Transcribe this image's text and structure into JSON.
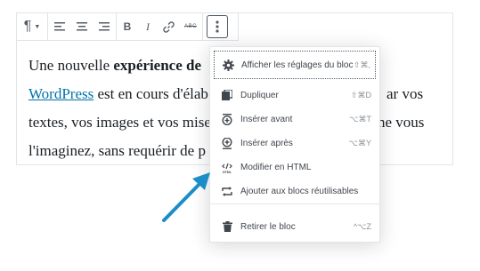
{
  "toolbar": {
    "paragraph_icon": "paragraph-icon",
    "align_left_icon": "align-left-icon",
    "align_center_icon": "align-center-icon",
    "align_right_icon": "align-right-icon",
    "bold_label": "B",
    "italic_label": "I",
    "link_icon": "link-icon",
    "strikethrough_label": "ABC",
    "more_icon": "more-vertical-icon"
  },
  "paragraph": {
    "line1_start": "Une nouvelle ",
    "line1_bold": "expérience de",
    "line1_end": " ",
    "line2_link": "WordPress",
    "line2_text": " est en cours d'élab",
    "line2_end": "ar vos",
    "line3_text": "textes, vos images et vos mise",
    "line3_end": "ne vous",
    "line4_text": "l'imaginez, sans requérir de p"
  },
  "menu": {
    "items": [
      {
        "label": "Afficher les réglages du bloc",
        "shortcut": "⇧⌘,",
        "icon": "gear-icon"
      },
      {
        "label": "Dupliquer",
        "shortcut": "⇧⌘D",
        "icon": "duplicate-icon"
      },
      {
        "label": "Insérer avant",
        "shortcut": "⌥⌘T",
        "icon": "insert-before-icon"
      },
      {
        "label": "Insérer après",
        "shortcut": "⌥⌘Y",
        "icon": "insert-after-icon"
      },
      {
        "label": "Modifier en HTML",
        "shortcut": "",
        "icon": "html-icon"
      },
      {
        "label": "Ajouter aux blocs réutilisables",
        "shortcut": "",
        "icon": "reusable-icon"
      },
      {
        "label": "Retirer le bloc",
        "shortcut": "^⌥Z",
        "icon": "trash-icon"
      }
    ]
  },
  "colors": {
    "link": "#0073aa",
    "arrow": "#1b8ec7",
    "text": "#191e23"
  }
}
